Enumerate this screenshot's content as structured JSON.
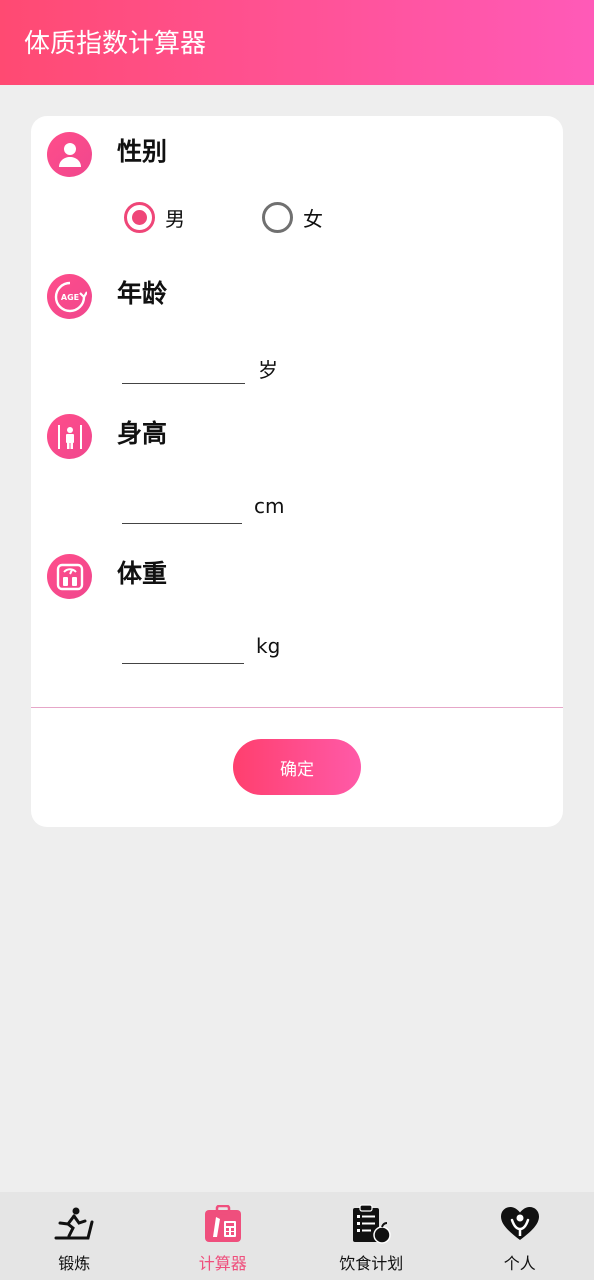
{
  "header": {
    "title": "体质指数计算器"
  },
  "colors": {
    "accent": "#ef4678",
    "header_gradient_start": "#ff4a72",
    "header_gradient_end": "#ff5ab8"
  },
  "form": {
    "gender": {
      "icon": "person-icon",
      "title": "性别",
      "options": [
        {
          "label": "男",
          "checked": true
        },
        {
          "label": "女",
          "checked": false
        }
      ]
    },
    "age": {
      "icon": "age-icon",
      "title": "年龄",
      "value": "",
      "unit": "岁"
    },
    "height": {
      "icon": "height-icon",
      "title": "身高",
      "value": "",
      "unit": "cm"
    },
    "weight": {
      "icon": "scale-icon",
      "title": "体重",
      "value": "",
      "unit": "kg"
    },
    "confirm_label": "确定"
  },
  "bottom_nav": {
    "items": [
      {
        "label": "锻炼",
        "icon": "treadmill-icon",
        "active": false
      },
      {
        "label": "计算器",
        "icon": "calculator-icon",
        "active": true
      },
      {
        "label": "饮食计划",
        "icon": "diet-plan-icon",
        "active": false
      },
      {
        "label": "个人",
        "icon": "heart-person-icon",
        "active": false
      }
    ]
  }
}
